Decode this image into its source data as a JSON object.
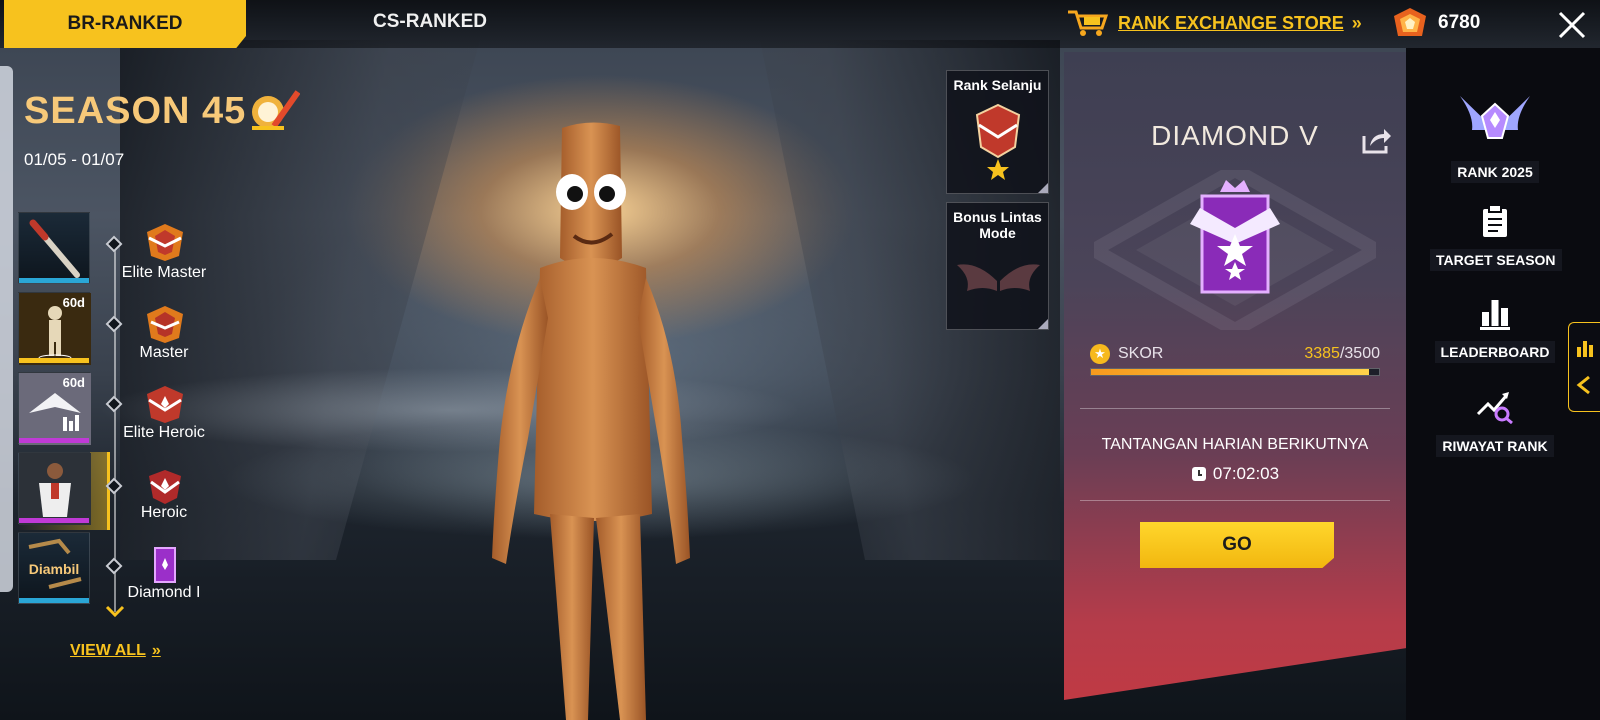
{
  "tabs": {
    "br_ranked": "BR-RANKED",
    "cs_ranked": "CS-RANKED"
  },
  "store": {
    "label": "RANK EXCHANGE STORE",
    "arrow": "»"
  },
  "currency": {
    "amount": "6780"
  },
  "season": {
    "title": "SEASON 45",
    "dates": "01/05 - 01/07"
  },
  "rewards": [
    {
      "time": "",
      "note": ""
    },
    {
      "time": "60d",
      "note": ""
    },
    {
      "time": "60d",
      "note": ""
    },
    {
      "time": "",
      "note": ""
    },
    {
      "time": "",
      "note": "Diambil"
    }
  ],
  "tiers": [
    {
      "label": "Elite Master"
    },
    {
      "label": "Master"
    },
    {
      "label": "Elite Heroic"
    },
    {
      "label": "Heroic"
    },
    {
      "label": "Diamond I"
    }
  ],
  "view_all": {
    "label": "VIEW ALL",
    "arrow": "»"
  },
  "side_cards": {
    "next_rank": "Rank Selanju",
    "bonus_line1": "Bonus Lintas",
    "bonus_line2": "Mode"
  },
  "rank": {
    "name": "DIAMOND V",
    "score_label": "SKOR",
    "score_current": "3385",
    "score_total": "/3500",
    "progress": 0.967,
    "daily_title": "TANTANGAN HARIAN BERIKUTNYA",
    "daily_time": "07:02:03",
    "go_label": "GO"
  },
  "menu": {
    "rank_2025": "RANK 2025",
    "target_season": "TARGET SEASON",
    "leaderboard": "LEADERBOARD",
    "riwayat_rank": "RIWAYAT RANK"
  },
  "colors": {
    "accent": "#f7c21e",
    "season_title": "#f7c979",
    "panel_top": "#3e3f52",
    "panel_bottom": "#c03a44"
  }
}
